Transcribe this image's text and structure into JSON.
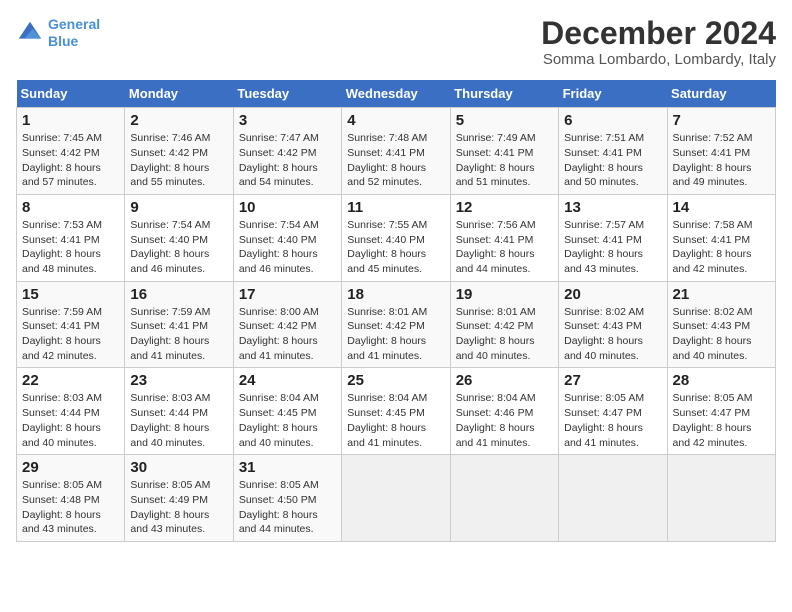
{
  "header": {
    "logo_line1": "General",
    "logo_line2": "Blue",
    "main_title": "December 2024",
    "subtitle": "Somma Lombardo, Lombardy, Italy"
  },
  "calendar": {
    "weekdays": [
      "Sunday",
      "Monday",
      "Tuesday",
      "Wednesday",
      "Thursday",
      "Friday",
      "Saturday"
    ],
    "weeks": [
      [
        {
          "day": "1",
          "sunrise": "Sunrise: 7:45 AM",
          "sunset": "Sunset: 4:42 PM",
          "daylight": "Daylight: 8 hours and 57 minutes."
        },
        {
          "day": "2",
          "sunrise": "Sunrise: 7:46 AM",
          "sunset": "Sunset: 4:42 PM",
          "daylight": "Daylight: 8 hours and 55 minutes."
        },
        {
          "day": "3",
          "sunrise": "Sunrise: 7:47 AM",
          "sunset": "Sunset: 4:42 PM",
          "daylight": "Daylight: 8 hours and 54 minutes."
        },
        {
          "day": "4",
          "sunrise": "Sunrise: 7:48 AM",
          "sunset": "Sunset: 4:41 PM",
          "daylight": "Daylight: 8 hours and 52 minutes."
        },
        {
          "day": "5",
          "sunrise": "Sunrise: 7:49 AM",
          "sunset": "Sunset: 4:41 PM",
          "daylight": "Daylight: 8 hours and 51 minutes."
        },
        {
          "day": "6",
          "sunrise": "Sunrise: 7:51 AM",
          "sunset": "Sunset: 4:41 PM",
          "daylight": "Daylight: 8 hours and 50 minutes."
        },
        {
          "day": "7",
          "sunrise": "Sunrise: 7:52 AM",
          "sunset": "Sunset: 4:41 PM",
          "daylight": "Daylight: 8 hours and 49 minutes."
        }
      ],
      [
        {
          "day": "8",
          "sunrise": "Sunrise: 7:53 AM",
          "sunset": "Sunset: 4:41 PM",
          "daylight": "Daylight: 8 hours and 48 minutes."
        },
        {
          "day": "9",
          "sunrise": "Sunrise: 7:54 AM",
          "sunset": "Sunset: 4:40 PM",
          "daylight": "Daylight: 8 hours and 46 minutes."
        },
        {
          "day": "10",
          "sunrise": "Sunrise: 7:54 AM",
          "sunset": "Sunset: 4:40 PM",
          "daylight": "Daylight: 8 hours and 46 minutes."
        },
        {
          "day": "11",
          "sunrise": "Sunrise: 7:55 AM",
          "sunset": "Sunset: 4:40 PM",
          "daylight": "Daylight: 8 hours and 45 minutes."
        },
        {
          "day": "12",
          "sunrise": "Sunrise: 7:56 AM",
          "sunset": "Sunset: 4:41 PM",
          "daylight": "Daylight: 8 hours and 44 minutes."
        },
        {
          "day": "13",
          "sunrise": "Sunrise: 7:57 AM",
          "sunset": "Sunset: 4:41 PM",
          "daylight": "Daylight: 8 hours and 43 minutes."
        },
        {
          "day": "14",
          "sunrise": "Sunrise: 7:58 AM",
          "sunset": "Sunset: 4:41 PM",
          "daylight": "Daylight: 8 hours and 42 minutes."
        }
      ],
      [
        {
          "day": "15",
          "sunrise": "Sunrise: 7:59 AM",
          "sunset": "Sunset: 4:41 PM",
          "daylight": "Daylight: 8 hours and 42 minutes."
        },
        {
          "day": "16",
          "sunrise": "Sunrise: 7:59 AM",
          "sunset": "Sunset: 4:41 PM",
          "daylight": "Daylight: 8 hours and 41 minutes."
        },
        {
          "day": "17",
          "sunrise": "Sunrise: 8:00 AM",
          "sunset": "Sunset: 4:42 PM",
          "daylight": "Daylight: 8 hours and 41 minutes."
        },
        {
          "day": "18",
          "sunrise": "Sunrise: 8:01 AM",
          "sunset": "Sunset: 4:42 PM",
          "daylight": "Daylight: 8 hours and 41 minutes."
        },
        {
          "day": "19",
          "sunrise": "Sunrise: 8:01 AM",
          "sunset": "Sunset: 4:42 PM",
          "daylight": "Daylight: 8 hours and 40 minutes."
        },
        {
          "day": "20",
          "sunrise": "Sunrise: 8:02 AM",
          "sunset": "Sunset: 4:43 PM",
          "daylight": "Daylight: 8 hours and 40 minutes."
        },
        {
          "day": "21",
          "sunrise": "Sunrise: 8:02 AM",
          "sunset": "Sunset: 4:43 PM",
          "daylight": "Daylight: 8 hours and 40 minutes."
        }
      ],
      [
        {
          "day": "22",
          "sunrise": "Sunrise: 8:03 AM",
          "sunset": "Sunset: 4:44 PM",
          "daylight": "Daylight: 8 hours and 40 minutes."
        },
        {
          "day": "23",
          "sunrise": "Sunrise: 8:03 AM",
          "sunset": "Sunset: 4:44 PM",
          "daylight": "Daylight: 8 hours and 40 minutes."
        },
        {
          "day": "24",
          "sunrise": "Sunrise: 8:04 AM",
          "sunset": "Sunset: 4:45 PM",
          "daylight": "Daylight: 8 hours and 40 minutes."
        },
        {
          "day": "25",
          "sunrise": "Sunrise: 8:04 AM",
          "sunset": "Sunset: 4:45 PM",
          "daylight": "Daylight: 8 hours and 41 minutes."
        },
        {
          "day": "26",
          "sunrise": "Sunrise: 8:04 AM",
          "sunset": "Sunset: 4:46 PM",
          "daylight": "Daylight: 8 hours and 41 minutes."
        },
        {
          "day": "27",
          "sunrise": "Sunrise: 8:05 AM",
          "sunset": "Sunset: 4:47 PM",
          "daylight": "Daylight: 8 hours and 41 minutes."
        },
        {
          "day": "28",
          "sunrise": "Sunrise: 8:05 AM",
          "sunset": "Sunset: 4:47 PM",
          "daylight": "Daylight: 8 hours and 42 minutes."
        }
      ],
      [
        {
          "day": "29",
          "sunrise": "Sunrise: 8:05 AM",
          "sunset": "Sunset: 4:48 PM",
          "daylight": "Daylight: 8 hours and 43 minutes."
        },
        {
          "day": "30",
          "sunrise": "Sunrise: 8:05 AM",
          "sunset": "Sunset: 4:49 PM",
          "daylight": "Daylight: 8 hours and 43 minutes."
        },
        {
          "day": "31",
          "sunrise": "Sunrise: 8:05 AM",
          "sunset": "Sunset: 4:50 PM",
          "daylight": "Daylight: 8 hours and 44 minutes."
        },
        null,
        null,
        null,
        null
      ]
    ]
  }
}
